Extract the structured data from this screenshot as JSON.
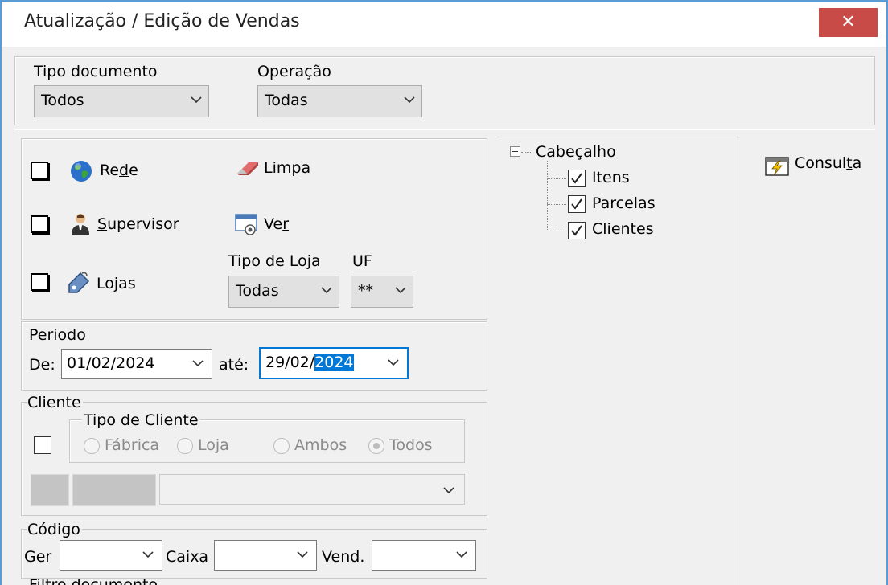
{
  "window": {
    "title": "Atualização / Edição de Vendas",
    "close_glyph": "✕"
  },
  "top": {
    "tipo_documento": {
      "label": "Tipo documento",
      "value": "Todos"
    },
    "operacao": {
      "label": "Operação",
      "value": "Todas"
    }
  },
  "filters": {
    "rede": {
      "pre": "Re",
      "u": "d",
      "post": "e",
      "checked": false,
      "icon": "globe-icon"
    },
    "supervisor": {
      "u": "S",
      "post": "upervisor",
      "checked": false,
      "icon": "person-icon"
    },
    "lojas": {
      "pre": "Lo",
      "u": "j",
      "post": "as",
      "checked": false,
      "icon": "tag-icon"
    },
    "limpa": {
      "pre": "Lim",
      "u": "p",
      "post": "a",
      "icon": "eraser-icon"
    },
    "ver": {
      "pre": "Ve",
      "u": "r",
      "post": "",
      "icon": "view-icon"
    },
    "tipo_loja": {
      "label": "Tipo de Loja",
      "value": "Todas"
    },
    "uf": {
      "label": "UF",
      "value": "**"
    }
  },
  "periodo": {
    "label": "Periodo",
    "de_label": "De:",
    "de_value": "01/02/2024",
    "ate_label": "até:",
    "ate_value_plain": "29/02/",
    "ate_value_selected": "2024"
  },
  "cliente": {
    "label": "Cliente",
    "tipo_label": "Tipo de Cliente",
    "options": [
      "Fábrica",
      "Loja",
      "Ambos",
      "Todos"
    ],
    "selected": "Todos"
  },
  "codigo": {
    "label": "Código",
    "ger_label": "Ger",
    "caixa_label": "Caixa",
    "vend_label": "Vend."
  },
  "tree": {
    "root": "Cabeçalho",
    "expander": "⊟",
    "children": [
      {
        "label": "Itens",
        "checked": true
      },
      {
        "label": "Parcelas",
        "checked": true
      },
      {
        "label": "Clientes",
        "checked": true
      }
    ]
  },
  "consulta": {
    "pre": "Consul",
    "u": "t",
    "post": "a",
    "icon": "lightning-doc-icon"
  },
  "bottom_cut_label": "Filtro documento"
}
